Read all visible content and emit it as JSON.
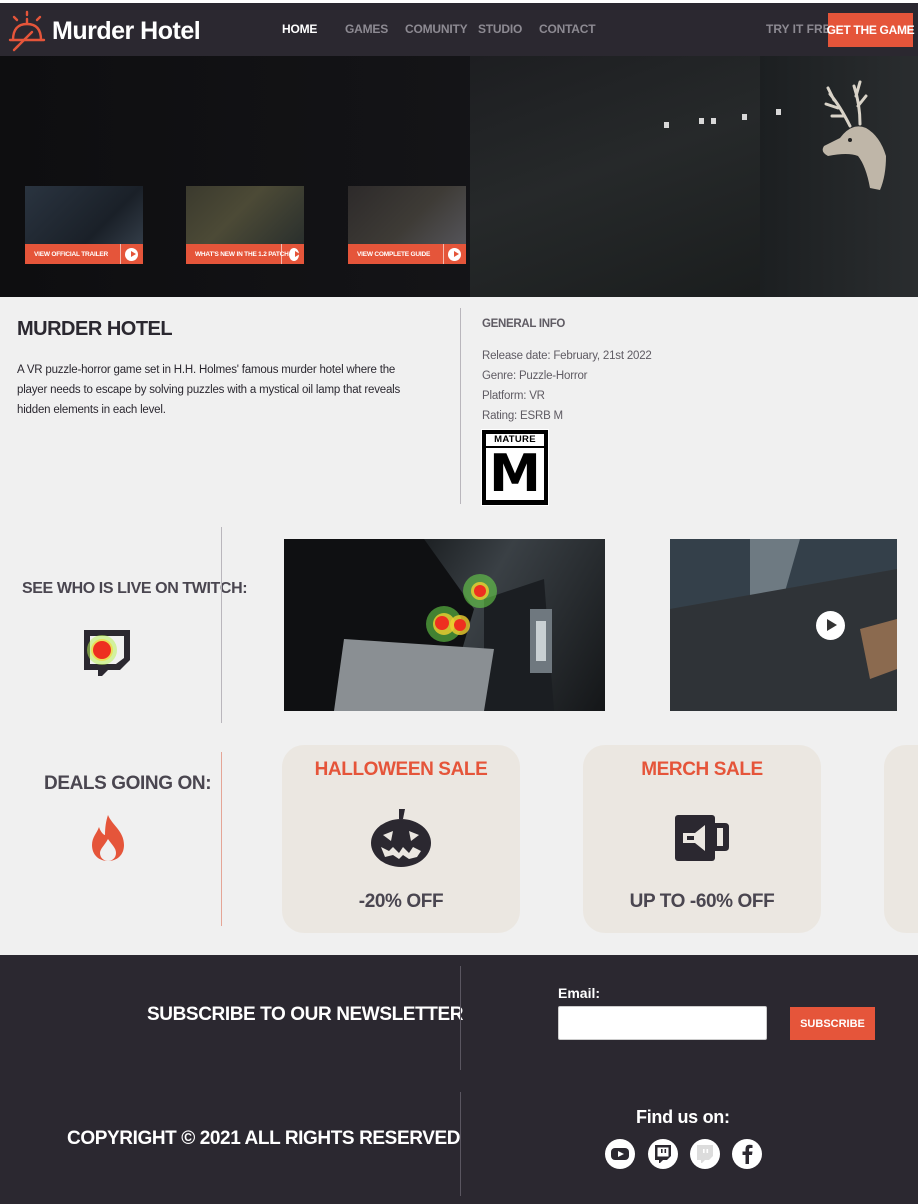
{
  "brand": {
    "name": "Murder Hotel",
    "accent": "#e5553a",
    "dark": "#2b2830"
  },
  "nav": {
    "links": [
      "HOME",
      "GAMES",
      "COMUNITY",
      "STUDIO",
      "CONTACT"
    ],
    "active": "HOME",
    "try_free": "TRY IT FREE",
    "get_game": "GET THE GAME"
  },
  "hero": {
    "thumbnails": [
      {
        "label": "VIEW OFFICIAL TRAILER"
      },
      {
        "label": "WHAT'S NEW IN THE 1.2 PATCH"
      },
      {
        "label": "VIEW COMPLETE GUIDE"
      }
    ]
  },
  "game": {
    "title": "MURDER HOTEL",
    "description": "A VR puzzle-horror game set in H.H. Holmes' famous murder hotel where the player needs to escape by solving puzzles with a mystical oil lamp that reveals hidden elements in each level."
  },
  "general_info": {
    "title": "GENERAL INFO",
    "release": "Release date: February, 21st 2022",
    "genre": "Genre: Puzzle-Horror",
    "platform": "Platform: VR",
    "rating": "Rating: ESRB M",
    "esrb_top": "MATURE",
    "esrb_letter": "M"
  },
  "twitch": {
    "label": "SEE WHO IS LIVE ON TWITCH:"
  },
  "deals": {
    "label": "DEALS GOING ON:",
    "cards": [
      {
        "title": "HALLOWEEN SALE",
        "offer": "-20% OFF",
        "icon": "pumpkin-icon"
      },
      {
        "title": "MERCH SALE",
        "offer": "UP TO -60% OFF",
        "icon": "mug-icon"
      }
    ]
  },
  "footer": {
    "newsletter_title": "SUBSCRIBE TO OUR NEWSLETTER",
    "email_label": "Email:",
    "subscribe": "SUBSCRIBE",
    "copyright": "COPYRIGHT © 2021 ALL RIGHTS RESERVED",
    "find_us": "Find us on:",
    "socials": [
      "youtube-icon",
      "twitch-icon",
      "twitch-icon",
      "facebook-icon"
    ]
  }
}
